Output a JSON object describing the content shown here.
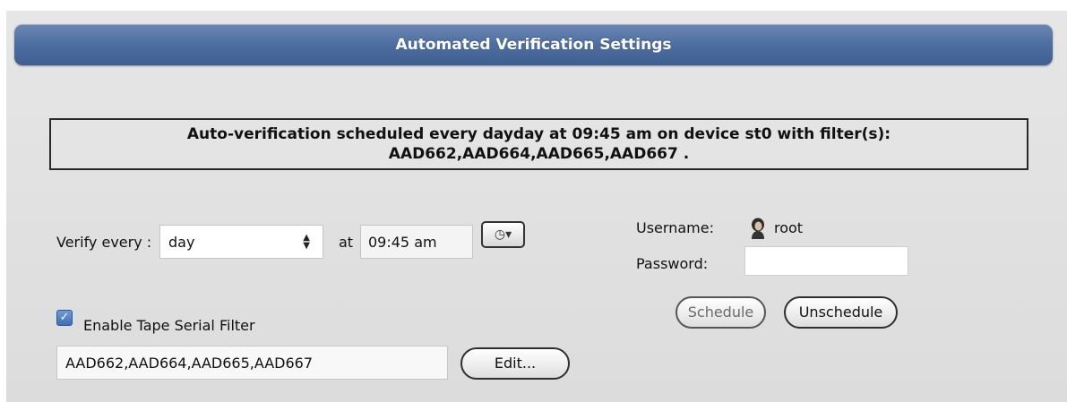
{
  "header": {
    "title": "Automated Verification Settings"
  },
  "status": {
    "line1": "Auto-verification scheduled every dayday at 09:45 am on device st0 with filter(s):",
    "line2": "AAD662,AAD664,AAD665,AAD667 ."
  },
  "schedule": {
    "verify_every_label": "Verify every :",
    "frequency_value": "day",
    "at_label": "at",
    "time_value": "09:45 am",
    "clock_icon": "clock-dropdown-icon"
  },
  "filter": {
    "checkbox_checked": true,
    "checkbox_label": "Enable Tape Serial Filter",
    "value": "AAD662,AAD664,AAD665,AAD667",
    "edit_label": "Edit..."
  },
  "auth": {
    "username_label": "Username:",
    "username_value": "root",
    "user_icon": "user-avatar-icon",
    "password_label": "Password:",
    "password_value": ""
  },
  "actions": {
    "schedule_label": "Schedule",
    "schedule_enabled": false,
    "unschedule_label": "Unschedule"
  },
  "colors": {
    "header_bar": "#4e6ea0",
    "panel_bg": "#e0e0e0",
    "checkbox_accent": "#3f6fb8"
  }
}
